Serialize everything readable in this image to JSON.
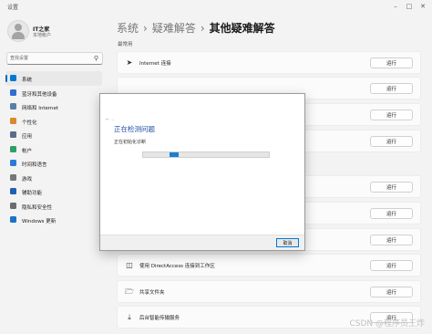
{
  "window": {
    "title": "设置"
  },
  "user": {
    "name": "IT之家",
    "type": "本地帐户"
  },
  "search": {
    "placeholder": "查找设置"
  },
  "nav": [
    {
      "label": "系统",
      "icon": "monitor-icon",
      "color": "#0078d4",
      "active": true
    },
    {
      "label": "蓝牙和其他设备",
      "icon": "bluetooth-icon",
      "color": "#2f6fd1"
    },
    {
      "label": "网络和 Internet",
      "icon": "network-icon",
      "color": "#5a7fa8"
    },
    {
      "label": "个性化",
      "icon": "brush-icon",
      "color": "#d98a2b"
    },
    {
      "label": "应用",
      "icon": "apps-icon",
      "color": "#5b6c87"
    },
    {
      "label": "帐户",
      "icon": "account-icon",
      "color": "#2aa065"
    },
    {
      "label": "时间和语言",
      "icon": "globe-clock-icon",
      "color": "#2b7bd6"
    },
    {
      "label": "游戏",
      "icon": "gamepad-icon",
      "color": "#777777"
    },
    {
      "label": "辅助功能",
      "icon": "accessibility-icon",
      "color": "#1f5fb5"
    },
    {
      "label": "隐私和安全性",
      "icon": "shield-icon",
      "color": "#6b6b6b"
    },
    {
      "label": "Windows 更新",
      "icon": "windows-update-icon",
      "color": "#1a73c9"
    }
  ],
  "breadcrumb": {
    "part1": "系统",
    "part2": "疑难解答",
    "current": "其他疑难解答"
  },
  "section_label": "最常用",
  "rows": [
    {
      "label": "Internet 连接",
      "icon": "wifi-icon",
      "button": "运行"
    },
    {
      "label": "",
      "icon": "",
      "button": "运行"
    },
    {
      "label": "",
      "icon": "",
      "button": "运行"
    },
    {
      "label": "",
      "icon": "",
      "button": "运行"
    },
    {
      "label": "",
      "icon": "",
      "button": "运行"
    },
    {
      "label": "",
      "icon": "",
      "button": "运行"
    },
    {
      "label": "",
      "icon": "",
      "button": "运行"
    },
    {
      "label": "使用 DirectAccess 连接到工作区",
      "icon": "directaccess-icon",
      "button": "运行"
    },
    {
      "label": "共享文件夹",
      "icon": "shared-folder-icon",
      "button": "运行"
    },
    {
      "label": "后台智能传输服务",
      "icon": "download-icon",
      "button": "运行"
    }
  ],
  "dialog": {
    "back_label": "← ...",
    "heading": "正在检测问题",
    "status": "正在初始化诊断",
    "progress_percent": 21,
    "cancel_label": "取消"
  },
  "watermark": "CSDN @程序员王炸"
}
